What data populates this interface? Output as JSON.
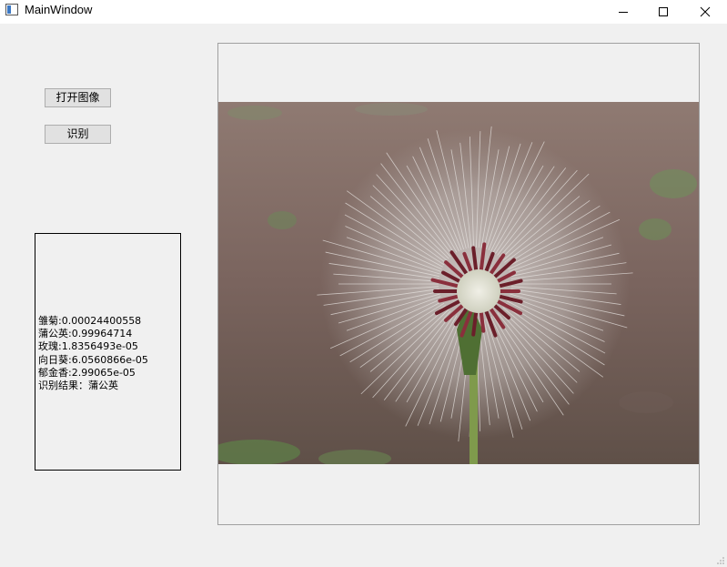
{
  "window": {
    "title": "MainWindow"
  },
  "buttons": {
    "open_image": "打开图像",
    "recognize": "识别"
  },
  "results": {
    "lines": [
      "雏菊:0.00024400558",
      "蒲公英:0.99964714",
      "玫瑰:1.8356493e-05",
      "向日葵:6.0560866e-05",
      "郁金香:2.99065e-05",
      "识别结果：蒲公英"
    ]
  },
  "icons": {
    "app": "window-icon",
    "minimize": "minimize-icon",
    "maximize": "maximize-icon",
    "close": "close-icon"
  },
  "colors": {
    "window_bg": "#f0f0f0",
    "titlebar_bg": "#ffffff",
    "button_bg": "#e1e1e1"
  }
}
